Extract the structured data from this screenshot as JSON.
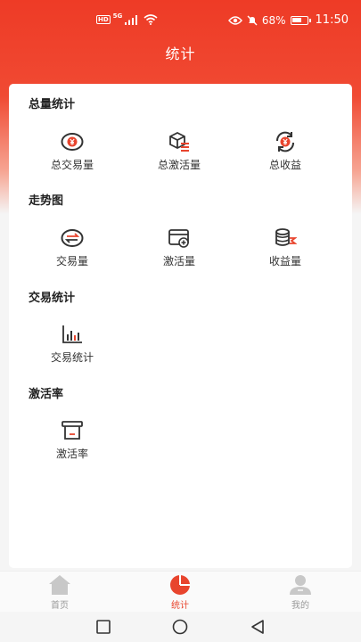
{
  "status_bar": {
    "network_badge": "HD",
    "network_type": "5G",
    "battery_percent": "68%",
    "battery_level": 0.68,
    "time": "11:50"
  },
  "header": {
    "title": "统计"
  },
  "sections": [
    {
      "title": "总量统计",
      "items": [
        {
          "label": "总交易量",
          "icon": "yuan-circle-icon"
        },
        {
          "label": "总激活量",
          "icon": "cube-list-icon"
        },
        {
          "label": "总收益",
          "icon": "yuan-refresh-icon"
        }
      ]
    },
    {
      "title": "走势图",
      "items": [
        {
          "label": "交易量",
          "icon": "exchange-icon"
        },
        {
          "label": "激活量",
          "icon": "card-plus-icon"
        },
        {
          "label": "收益量",
          "icon": "coins-icon"
        }
      ]
    },
    {
      "title": "交易统计",
      "items": [
        {
          "label": "交易统计",
          "icon": "bar-chart-icon"
        }
      ]
    },
    {
      "title": "激活率",
      "items": [
        {
          "label": "激活率",
          "icon": "pos-terminal-icon"
        }
      ]
    }
  ],
  "bottom_nav": [
    {
      "label": "首页",
      "icon": "home-icon",
      "active": false
    },
    {
      "label": "统计",
      "icon": "pie-chart-icon",
      "active": true
    },
    {
      "label": "我的",
      "icon": "user-icon",
      "active": false
    }
  ],
  "colors": {
    "accent": "#e8452e",
    "header": "#ee3b26",
    "icon_dark": "#333333"
  }
}
